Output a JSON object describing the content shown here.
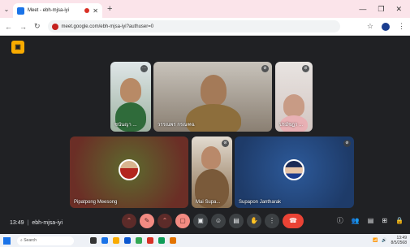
{
  "browser": {
    "tab_title": "Meet - ebh-mjsa-iyi",
    "url": "meet.google.com/ebh-mjsa-iyi?authuser=0"
  },
  "meeting": {
    "time": "13:49",
    "separator": "|",
    "code": "ebh-mjsa-iyi"
  },
  "participants": [
    {
      "name": "ชนันญา ..."
    },
    {
      "name": "วรรณพร กรณฑฉ"
    },
    {
      "name": "ปรมัชฎา ..."
    },
    {
      "name": "Pipatpong Meesong"
    },
    {
      "name": "Mai Supa..."
    },
    {
      "name": "Supapon Jantharak"
    }
  ],
  "taskbar": {
    "search_placeholder": "Search",
    "clock_time": "13:49",
    "clock_date": "8/5/2568"
  },
  "colors": {
    "meet_bg": "#202124",
    "leave": "#ea4335",
    "tab_bar": "#fbe4ea"
  }
}
